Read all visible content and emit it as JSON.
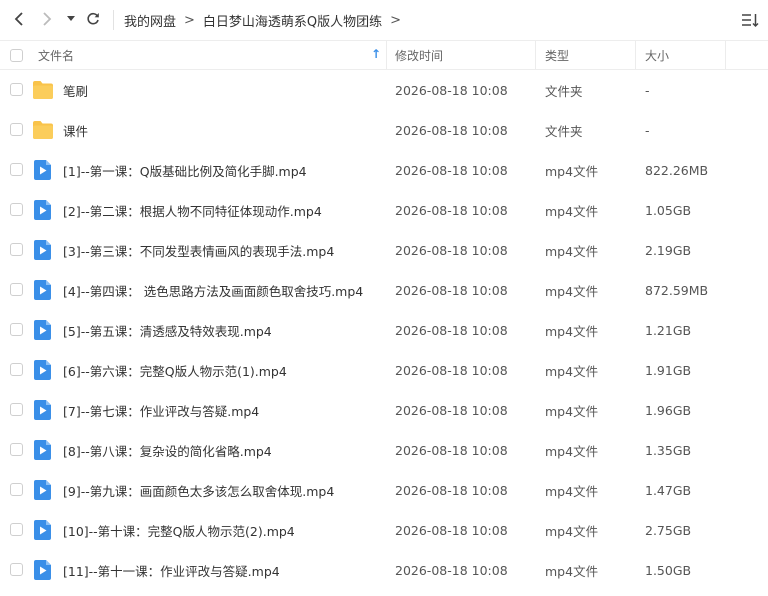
{
  "nav": {
    "breadcrumb": [
      "我的网盘",
      "白日梦山海透萌系Q版人物团练"
    ],
    "crumb_separator": ">"
  },
  "columns": {
    "name": "文件名",
    "modified": "修改时间",
    "type": "类型",
    "size": "大小",
    "sort_indicator": "↑"
  },
  "colors": {
    "folder": "#F9C34A",
    "video": "#3A8FE8",
    "sort_arrow": "#3A8FE8"
  },
  "files": [
    {
      "icon": "folder-icon",
      "name": "笔刷",
      "modified": "2026-08-18 10:08",
      "type": "文件夹",
      "size": "-"
    },
    {
      "icon": "folder-icon",
      "name": "课件",
      "modified": "2026-08-18 10:08",
      "type": "文件夹",
      "size": "-"
    },
    {
      "icon": "video-file-icon",
      "name": "[1]--第一课：Q版基础比例及简化手脚.mp4",
      "modified": "2026-08-18 10:08",
      "type": "mp4文件",
      "size": "822.26MB"
    },
    {
      "icon": "video-file-icon",
      "name": "[2]--第二课：根据人物不同特征体现动作.mp4",
      "modified": "2026-08-18 10:08",
      "type": "mp4文件",
      "size": "1.05GB"
    },
    {
      "icon": "video-file-icon",
      "name": "[3]--第三课：不同发型表情画风的表现手法.mp4",
      "modified": "2026-08-18 10:08",
      "type": "mp4文件",
      "size": "2.19GB"
    },
    {
      "icon": "video-file-icon",
      "name": "[4]--第四课： 选色思路方法及画面颜色取舍技巧.mp4",
      "modified": "2026-08-18 10:08",
      "type": "mp4文件",
      "size": "872.59MB"
    },
    {
      "icon": "video-file-icon",
      "name": "[5]--第五课：清透感及特效表现.mp4",
      "modified": "2026-08-18 10:08",
      "type": "mp4文件",
      "size": "1.21GB"
    },
    {
      "icon": "video-file-icon",
      "name": "[6]--第六课：完整Q版人物示范(1).mp4",
      "modified": "2026-08-18 10:08",
      "type": "mp4文件",
      "size": "1.91GB"
    },
    {
      "icon": "video-file-icon",
      "name": "[7]--第七课：作业评改与答疑.mp4",
      "modified": "2026-08-18 10:08",
      "type": "mp4文件",
      "size": "1.96GB"
    },
    {
      "icon": "video-file-icon",
      "name": "[8]--第八课：复杂设的简化省略.mp4",
      "modified": "2026-08-18 10:08",
      "type": "mp4文件",
      "size": "1.35GB"
    },
    {
      "icon": "video-file-icon",
      "name": "[9]--第九课：画面颜色太多该怎么取舍体现.mp4",
      "modified": "2026-08-18 10:08",
      "type": "mp4文件",
      "size": "1.47GB"
    },
    {
      "icon": "video-file-icon",
      "name": "[10]--第十课：完整Q版人物示范(2).mp4",
      "modified": "2026-08-18 10:08",
      "type": "mp4文件",
      "size": "2.75GB"
    },
    {
      "icon": "video-file-icon",
      "name": "[11]--第十一课：作业评改与答疑.mp4",
      "modified": "2026-08-18 10:08",
      "type": "mp4文件",
      "size": "1.50GB"
    }
  ]
}
